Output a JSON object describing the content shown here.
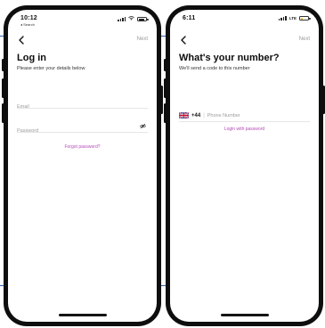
{
  "login_screen": {
    "status_time": "10:12",
    "status_back_app": "◂ Search",
    "back_icon": "chevron-left-icon",
    "next_label": "Next",
    "title": "Log in",
    "subtitle": "Please enter your details below",
    "email_placeholder": "Email",
    "password_placeholder": "Password",
    "password_toggle_icon": "eye-slash-icon",
    "forgot_password_label": "Forgot password?"
  },
  "phone_screen": {
    "status_time": "6:11",
    "network_label": "LTE",
    "back_icon": "chevron-left-icon",
    "next_label": "Next",
    "title": "What's your number?",
    "subtitle": "We'll send a code to this number",
    "flag_icon": "uk-flag-icon",
    "dial_code": "+44",
    "phone_placeholder": "Phone Number",
    "login_with_password_label": "Login with password"
  },
  "colors": {
    "accent_link": "#b44bb8",
    "phone_frame": "#0e0e0e",
    "guide_line": "#2f5fb3",
    "battery_low": "#f0c419"
  }
}
